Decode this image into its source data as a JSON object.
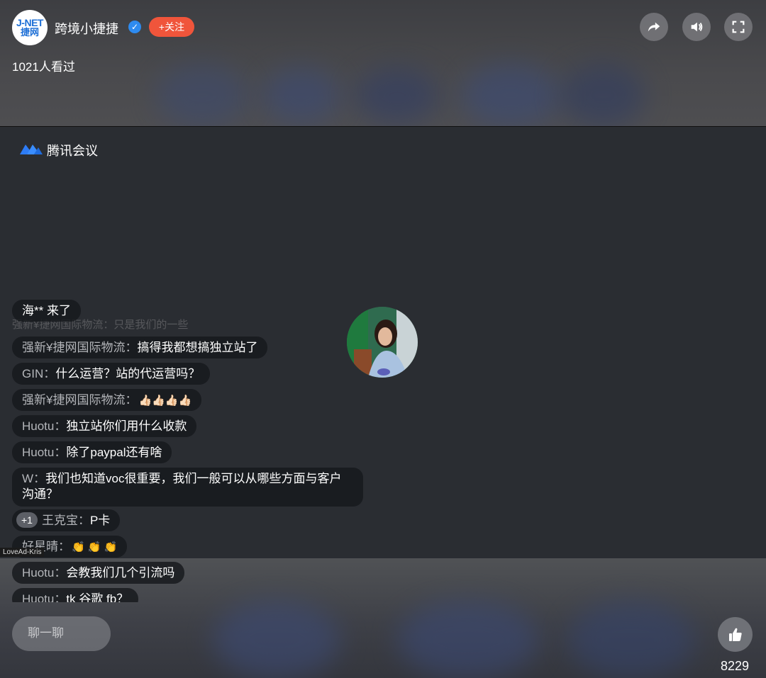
{
  "header": {
    "avatar_line1": "J-NET",
    "avatar_line2": "捷网",
    "host_name": "跨境小捷捷",
    "follow_label": "+关注",
    "view_count": "1021人看过",
    "icons": [
      "share-icon",
      "volume-icon",
      "fullscreen-icon"
    ]
  },
  "meeting": {
    "app_name": "腾讯会议"
  },
  "chat": {
    "join_notice": {
      "text": "海** 来了"
    },
    "ghost_text": "强新¥捷网国际物流：只是我们的一些",
    "messages": [
      {
        "name": "强新¥捷网国际物流：",
        "text": "搞得我都想搞独立站了"
      },
      {
        "name": "GIN：",
        "text": "什么运营？站的代运营吗？"
      },
      {
        "name": "强新¥捷网国际物流：",
        "text": "👍🏻👍🏻👍🏻👍🏻"
      },
      {
        "name": "Huotu：",
        "text": "独立站你们用什么收款"
      },
      {
        "name": "Huotu：",
        "text": "除了paypal还有啥"
      },
      {
        "name": "W：",
        "text": "我们也知道voc很重要，我们一般可以从哪些方面与客户沟通？"
      },
      {
        "badge": "+1",
        "name": "王克宝：",
        "text": "P卡"
      },
      {
        "name": "好星晴：",
        "text": "👏 👏 👏"
      },
      {
        "name": "Huotu：",
        "text": "会教我们几个引流吗"
      },
      {
        "name": "Huotu：",
        "text": "tk 谷歌 fb？"
      }
    ]
  },
  "overlay_label": "LoveAd-Kris",
  "footer": {
    "chat_placeholder": "聊一聊",
    "like_count": "8229"
  },
  "colors": {
    "follow_button": "#f0553b",
    "verified_badge": "#2e8bf0",
    "chat_bubble": "#16181c"
  }
}
